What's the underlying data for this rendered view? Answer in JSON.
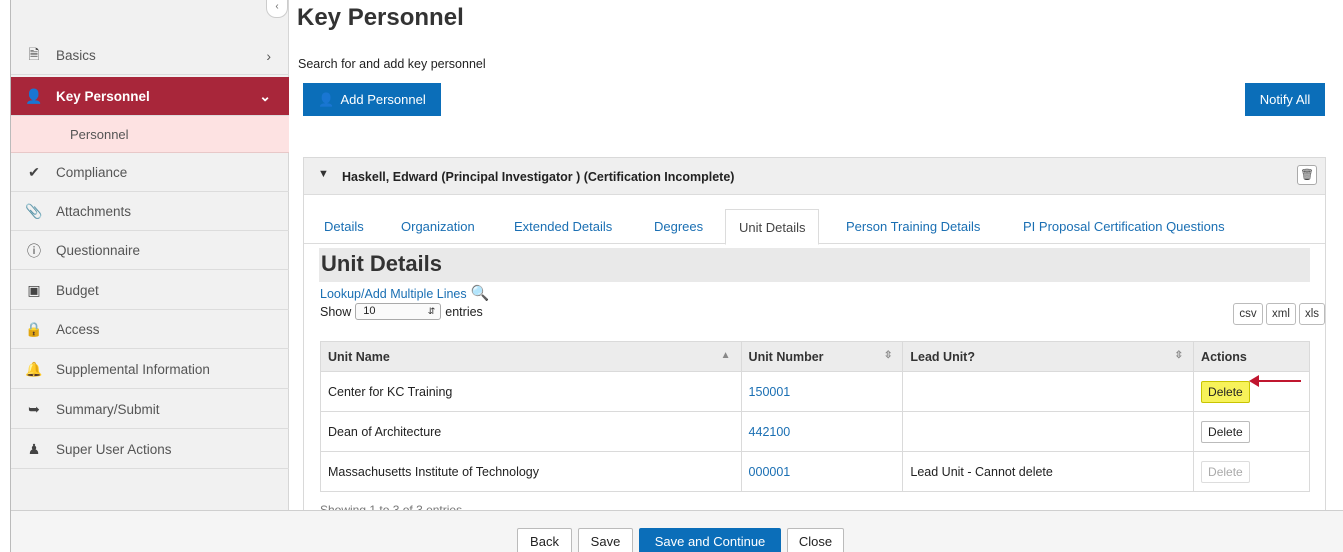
{
  "sidebar": {
    "collapse_icon": "chevron-left-icon",
    "items": [
      {
        "label": "Basics",
        "icon": "document-icon"
      },
      {
        "label": "Key Personnel",
        "icon": "user-icon"
      },
      {
        "label": "Compliance",
        "icon": "check-icon"
      },
      {
        "label": "Attachments",
        "icon": "paperclip-icon"
      },
      {
        "label": "Questionnaire",
        "icon": "question-icon"
      },
      {
        "label": "Budget",
        "icon": "money-icon"
      },
      {
        "label": "Access",
        "icon": "lock-icon"
      },
      {
        "label": "Supplemental Information",
        "icon": "bell-icon"
      },
      {
        "label": "Summary/Submit",
        "icon": "submit-icon"
      },
      {
        "label": "Super User Actions",
        "icon": "super-user-icon"
      }
    ],
    "sub_item": "Personnel",
    "active_color": "#a8263a"
  },
  "page": {
    "title": "Key Personnel",
    "subtitle": "Search for and add key personnel",
    "add_button": "Add Personnel",
    "notify_button": "Notify All"
  },
  "person": {
    "title": "Haskell, Edward (Principal Investigator ) (Certification Incomplete)"
  },
  "tabs": [
    "Details",
    "Organization",
    "Extended Details",
    "Degrees",
    "Unit Details",
    "Person Training Details",
    "PI Proposal Certification Questions"
  ],
  "active_tab": "Unit Details",
  "unit_details": {
    "title": "Unit Details",
    "lookup_link": "Lookup/Add Multiple Lines",
    "show_label": "Show",
    "show_value": "10",
    "entries_label": "entries",
    "export_buttons": [
      "csv",
      "xml",
      "xls"
    ],
    "columns": [
      "Unit Name",
      "Unit Number",
      "Lead Unit?",
      "Actions"
    ],
    "rows": [
      {
        "name": "Center for KC Training",
        "number": "150001",
        "lead": "",
        "action": "Delete"
      },
      {
        "name": "Dean of Architecture",
        "number": "442100",
        "lead": "",
        "action": "Delete"
      },
      {
        "name": "Massachusetts Institute of Technology",
        "number": "000001",
        "lead": "Lead Unit - Cannot delete",
        "action": "Delete"
      }
    ],
    "footer_text": "Showing 1 to 3 of 3 entries"
  },
  "footer": {
    "buttons": [
      "Back",
      "Save",
      "Save and Continue",
      "Close"
    ]
  },
  "colors": {
    "primary_blue": "#0b6eb9",
    "link_blue": "#1a6fb3",
    "highlight_yellow": "#f7f25a",
    "arrow_red": "#c0162f"
  }
}
